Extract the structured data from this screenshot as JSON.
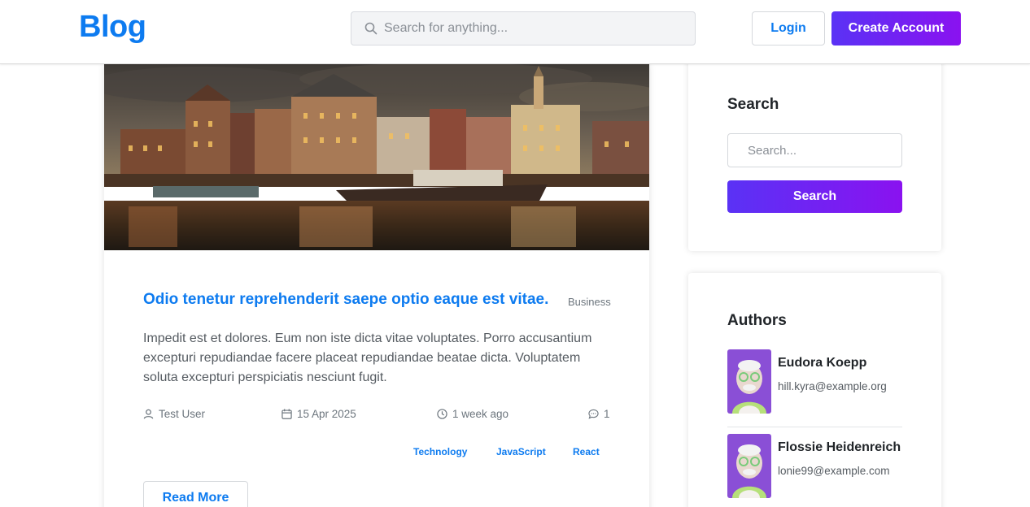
{
  "header": {
    "logo": "Blog",
    "search_placeholder": "Search for anything...",
    "login_label": "Login",
    "create_account_label": "Create Account"
  },
  "post": {
    "title": "Odio tenetur reprehenderit saepe optio eaque est vitae.",
    "category": "Business",
    "excerpt": "Impedit est et dolores. Eum non iste dicta vitae voluptates. Porro accusantium excepturi repudiandae facere placeat repudiandae beatae dicta. Voluptatem soluta excepturi perspiciatis nesciunt fugit.",
    "author": "Test User",
    "date": "15 Apr 2025",
    "relative_time": "1 week ago",
    "comments": "1",
    "tags": [
      "Technology",
      "JavaScript",
      "React"
    ],
    "read_more_label": "Read More"
  },
  "sidebar": {
    "search": {
      "heading": "Search",
      "placeholder": "Search...",
      "button_label": "Search"
    },
    "authors": {
      "heading": "Authors",
      "items": [
        {
          "name": "Eudora Koepp",
          "email": "hill.kyra@example.org"
        },
        {
          "name": "Flossie Heidenreich",
          "email": "lonie99@example.com"
        }
      ]
    }
  },
  "colors": {
    "accent": "#0d7bf0",
    "gradient_start": "#5a32f5",
    "gradient_end": "#8a12f0"
  }
}
